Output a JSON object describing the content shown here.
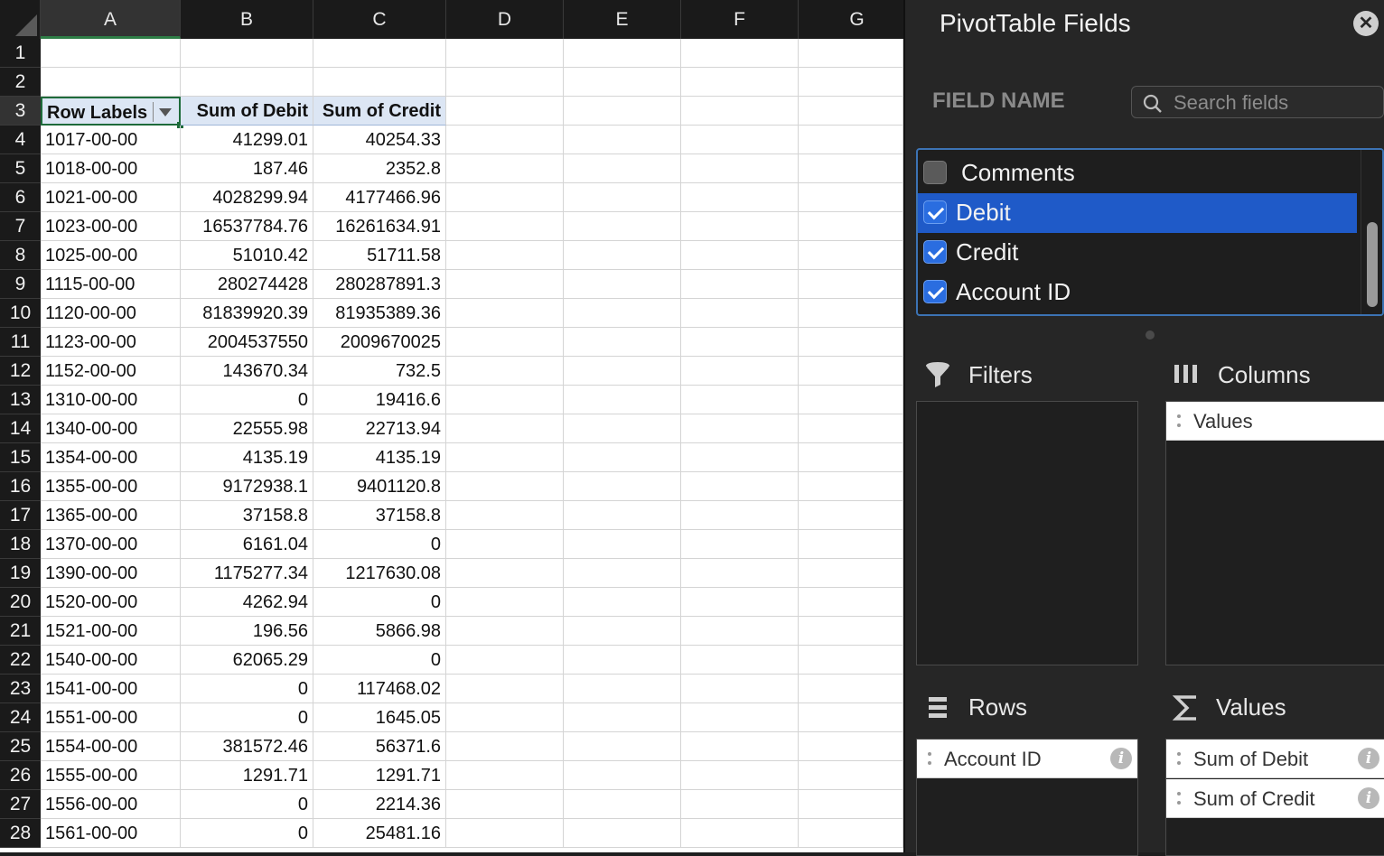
{
  "columns": [
    "A",
    "B",
    "C",
    "D",
    "E",
    "F",
    "G"
  ],
  "rows": [
    "1",
    "2",
    "3",
    "4",
    "5",
    "6",
    "7",
    "8",
    "9",
    "10",
    "11",
    "12",
    "13",
    "14",
    "15",
    "16",
    "17",
    "18",
    "19",
    "20",
    "21",
    "22",
    "23",
    "24",
    "25",
    "26",
    "27",
    "28"
  ],
  "pivot": {
    "headers": [
      "Row Labels",
      "Sum of Debit",
      "Sum of Credit"
    ],
    "data": [
      [
        "1017-00-00",
        "41299.01",
        "40254.33"
      ],
      [
        "1018-00-00",
        "187.46",
        "2352.8"
      ],
      [
        "1021-00-00",
        "4028299.94",
        "4177466.96"
      ],
      [
        "1023-00-00",
        "16537784.76",
        "16261634.91"
      ],
      [
        "1025-00-00",
        "51010.42",
        "51711.58"
      ],
      [
        "1115-00-00",
        "280274428",
        "280287891.3"
      ],
      [
        "1120-00-00",
        "81839920.39",
        "81935389.36"
      ],
      [
        "1123-00-00",
        "2004537550",
        "2009670025"
      ],
      [
        "1152-00-00",
        "143670.34",
        "732.5"
      ],
      [
        "1310-00-00",
        "0",
        "19416.6"
      ],
      [
        "1340-00-00",
        "22555.98",
        "22713.94"
      ],
      [
        "1354-00-00",
        "4135.19",
        "4135.19"
      ],
      [
        "1355-00-00",
        "9172938.1",
        "9401120.8"
      ],
      [
        "1365-00-00",
        "37158.8",
        "37158.8"
      ],
      [
        "1370-00-00",
        "6161.04",
        "0"
      ],
      [
        "1390-00-00",
        "1175277.34",
        "1217630.08"
      ],
      [
        "1520-00-00",
        "4262.94",
        "0"
      ],
      [
        "1521-00-00",
        "196.56",
        "5866.98"
      ],
      [
        "1540-00-00",
        "62065.29",
        "0"
      ],
      [
        "1541-00-00",
        "0",
        "117468.02"
      ],
      [
        "1551-00-00",
        "0",
        "1645.05"
      ],
      [
        "1554-00-00",
        "381572.46",
        "56371.6"
      ],
      [
        "1555-00-00",
        "1291.71",
        "1291.71"
      ],
      [
        "1556-00-00",
        "0",
        "2214.36"
      ],
      [
        "1561-00-00",
        "0",
        "25481.16"
      ]
    ]
  },
  "panel": {
    "title": "PivotTable Fields",
    "field_name_label": "FIELD NAME",
    "search_placeholder": "Search fields",
    "fields": [
      {
        "label": "Comments",
        "checked": false,
        "selected": false
      },
      {
        "label": "Debit",
        "checked": true,
        "selected": true
      },
      {
        "label": "Credit",
        "checked": true,
        "selected": false
      },
      {
        "label": "Account ID",
        "checked": true,
        "selected": false
      }
    ],
    "filters_label": "Filters",
    "columns_label": "Columns",
    "rows_label": "Rows",
    "values_label": "Values",
    "columns_items": [
      "Values"
    ],
    "rows_items": [
      "Account ID"
    ],
    "values_items": [
      "Sum of Debit",
      "Sum of Credit"
    ]
  }
}
